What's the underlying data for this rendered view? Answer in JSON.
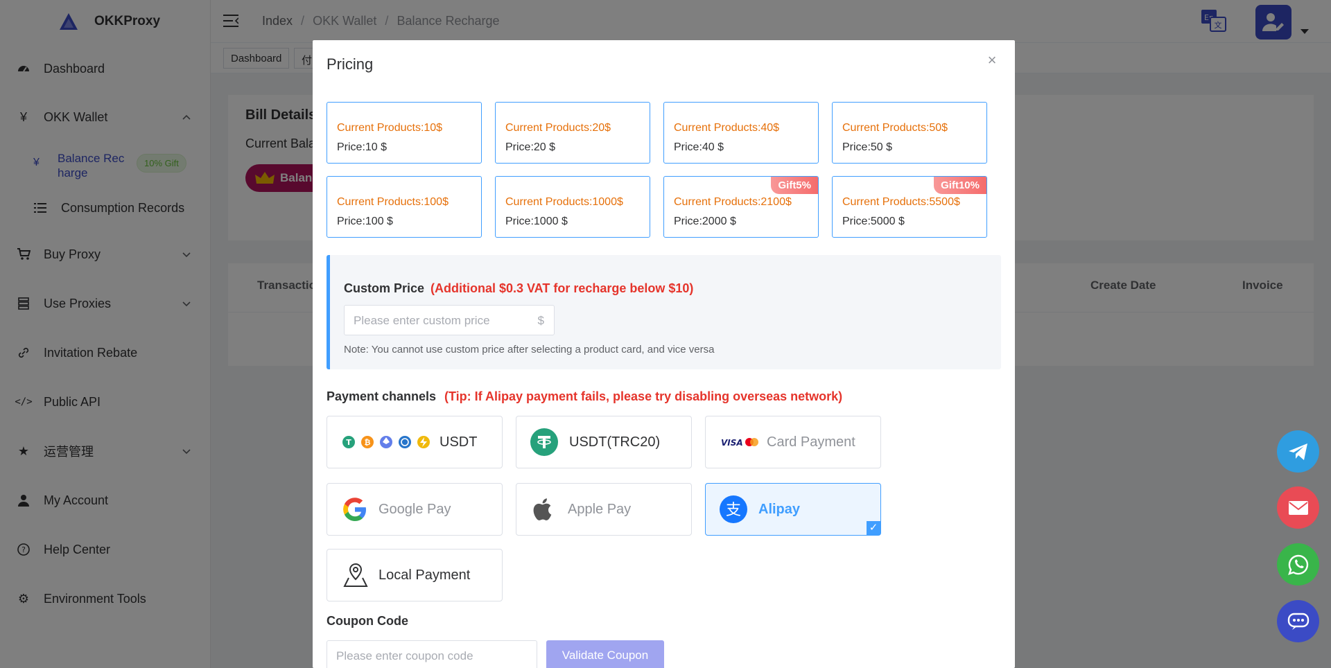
{
  "app": {
    "name": "OKKProxy"
  },
  "sidebar": {
    "items": [
      {
        "label": "Dashboard",
        "icon": "dashboard-icon"
      },
      {
        "label": "OKK Wallet",
        "icon": "yen-icon"
      },
      {
        "label": "Balance Recharge",
        "label_line1": "Balance Rec",
        "label_line2": "harge",
        "icon": "yen-icon",
        "badge": "10% Gift"
      },
      {
        "label": "Consumption Records",
        "icon": "list-icon"
      },
      {
        "label": "Buy Proxy",
        "icon": "cart-icon"
      },
      {
        "label": "Use Proxies",
        "icon": "server-icon"
      },
      {
        "label": "Invitation Rebate",
        "icon": "link-icon"
      },
      {
        "label": "Public API",
        "icon": "code-icon"
      },
      {
        "label": "运营管理",
        "icon": "star-icon"
      },
      {
        "label": "My Account",
        "icon": "user-icon"
      },
      {
        "label": "Help Center",
        "icon": "help-icon"
      },
      {
        "label": "Environment Tools",
        "icon": "gear-icon"
      }
    ]
  },
  "header": {
    "breadcrumb": [
      "Index",
      "OKK Wallet",
      "Balance Recharge"
    ],
    "separator": "/"
  },
  "tags": [
    "Dashboard",
    "付"
  ],
  "background": {
    "bill_title": "Bill Details",
    "current_balance": "Current Bala",
    "balance_btn": "Balanc",
    "table_headers": [
      "Transactio",
      "Create Date",
      "Invoice"
    ]
  },
  "modal": {
    "title": "Pricing",
    "products": [
      {
        "name": "Current Products:10$",
        "price": "Price:10 $",
        "gift": ""
      },
      {
        "name": "Current Products:20$",
        "price": "Price:20 $",
        "gift": ""
      },
      {
        "name": "Current Products:40$",
        "price": "Price:40 $",
        "gift": ""
      },
      {
        "name": "Current Products:50$",
        "price": "Price:50 $",
        "gift": ""
      },
      {
        "name": "Current Products:100$",
        "price": "Price:100 $",
        "gift": ""
      },
      {
        "name": "Current Products:1000$",
        "price": "Price:1000 $",
        "gift": ""
      },
      {
        "name": "Current Products:2100$",
        "price": "Price:2000 $",
        "gift": "Gift5%"
      },
      {
        "name": "Current Products:5500$",
        "price": "Price:5000 $",
        "gift": "Gift10%"
      }
    ],
    "custom_price": {
      "label": "Custom Price",
      "vat_note": "(Additional $0.3 VAT for recharge below $10)",
      "placeholder": "Please enter custom price",
      "suffix": "$",
      "hint": "Note: You cannot use custom price after selecting a product card, and vice versa"
    },
    "payment": {
      "title": "Payment channels",
      "tip": "(Tip: If Alipay payment fails, please try disabling overseas network)",
      "channels": [
        {
          "label": "USDT",
          "selected": false
        },
        {
          "label": "USDT(TRC20)",
          "selected": false
        },
        {
          "label": "Card Payment",
          "selected": false
        },
        {
          "label": "Google Pay",
          "selected": false
        },
        {
          "label": "Apple Pay",
          "selected": false
        },
        {
          "label": "Alipay",
          "selected": true
        },
        {
          "label": "Local Payment",
          "selected": false
        }
      ]
    },
    "coupon": {
      "title": "Coupon Code",
      "placeholder": "Please enter coupon code",
      "button": "Validate Coupon"
    }
  },
  "colors": {
    "primary": "#409eff",
    "accent_purple": "#3b4bc5",
    "warning_orange": "#e6700a",
    "danger_red": "#e5342b",
    "telegram": "#2f9de0",
    "mail": "#e94b55",
    "whatsapp": "#39b54a",
    "chat": "#3b4bc5"
  }
}
